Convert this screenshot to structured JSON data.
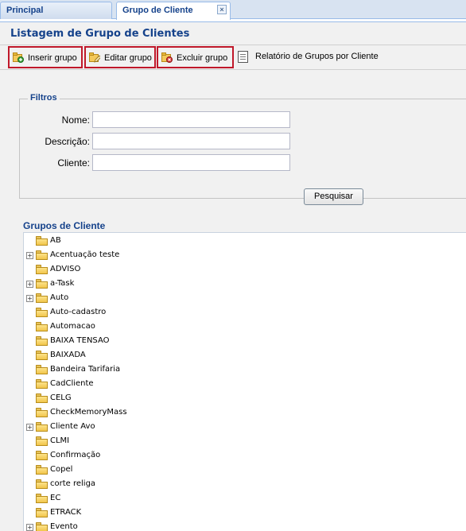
{
  "tabs": [
    {
      "label": "Principal"
    },
    {
      "label": "Grupo de Cliente",
      "close": "×"
    }
  ],
  "panel": {
    "title": "Listagem de Grupo de Clientes"
  },
  "toolbar": {
    "insert": "Inserir grupo",
    "edit": "Editar grupo",
    "delete": "Excluir grupo",
    "report": "Relatório de Grupos por Cliente"
  },
  "filters": {
    "legend": "Filtros",
    "fields": [
      {
        "label": "Nome:",
        "value": ""
      },
      {
        "label": "Descrição:",
        "value": ""
      },
      {
        "label": "Cliente:",
        "value": ""
      }
    ],
    "search_label": "Pesquisar"
  },
  "tree": {
    "title": "Grupos de Cliente",
    "nodes": [
      {
        "label": "AB",
        "expandable": false
      },
      {
        "label": "Acentuação teste",
        "expandable": true
      },
      {
        "label": "ADVISO",
        "expandable": false
      },
      {
        "label": "a-Task",
        "expandable": true
      },
      {
        "label": "Auto",
        "expandable": true
      },
      {
        "label": "Auto-cadastro",
        "expandable": false
      },
      {
        "label": "Automacao",
        "expandable": false
      },
      {
        "label": "BAIXA TENSAO",
        "expandable": false
      },
      {
        "label": "BAIXADA",
        "expandable": false
      },
      {
        "label": "Bandeira Tarifaria",
        "expandable": false
      },
      {
        "label": "CadCliente",
        "expandable": false
      },
      {
        "label": "CELG",
        "expandable": false
      },
      {
        "label": "CheckMemoryMass",
        "expandable": false
      },
      {
        "label": "Cliente Avo",
        "expandable": true
      },
      {
        "label": "CLMI",
        "expandable": false
      },
      {
        "label": "Confirmação",
        "expandable": false
      },
      {
        "label": "Copel",
        "expandable": false
      },
      {
        "label": "corte religa",
        "expandable": false
      },
      {
        "label": "EC",
        "expandable": false
      },
      {
        "label": "ETRACK",
        "expandable": false
      },
      {
        "label": "Evento",
        "expandable": true
      }
    ]
  },
  "colors": {
    "accent": "#15428b",
    "highlight": "#c0182a",
    "folder": "#f1c64c"
  }
}
